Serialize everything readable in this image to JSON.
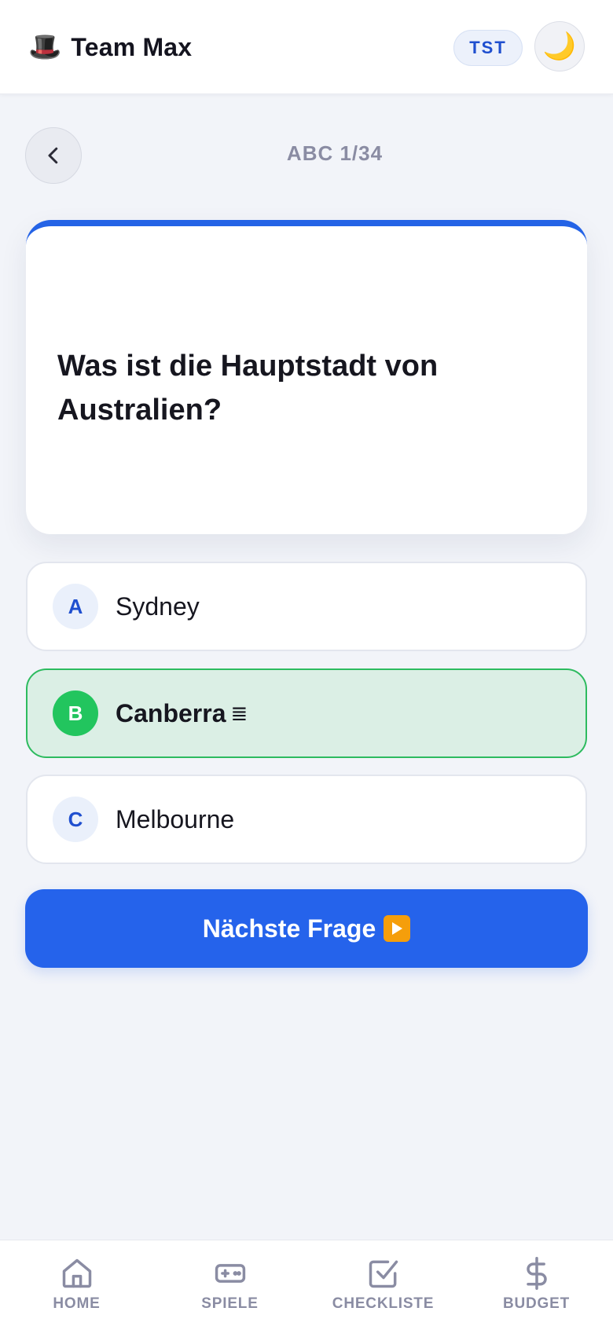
{
  "header": {
    "brand_icon": "top-hat-icon",
    "brand_emoji": "🎩",
    "brand_name": "Team Max",
    "badge": "TST",
    "theme_toggle_icon": "moon-icon",
    "theme_toggle_emoji": "🌙"
  },
  "quiz": {
    "progress": "ABC 1/34",
    "question": "Was ist die Hauptstadt von Australien?",
    "answers": [
      {
        "letter": "A",
        "text": "Sydney",
        "state": "default"
      },
      {
        "letter": "B",
        "text": "Canberra",
        "state": "correct",
        "marker": "≣"
      },
      {
        "letter": "C",
        "text": "Melbourne",
        "state": "default"
      }
    ],
    "next_label": "Nächste Frage",
    "next_icon": "play-button-icon"
  },
  "nav": {
    "items": [
      {
        "label": "HOME",
        "icon": "home-icon"
      },
      {
        "label": "SPIELE",
        "icon": "gamepad-icon"
      },
      {
        "label": "CHECKLISTE",
        "icon": "checkbox-icon"
      },
      {
        "label": "BUDGET",
        "icon": "dollar-icon"
      }
    ]
  },
  "colors": {
    "accent": "#2563eb",
    "correct": "#22c55e",
    "correct_bg": "#dbefe5",
    "background": "#f2f4f9",
    "muted": "#8a8ca3"
  }
}
